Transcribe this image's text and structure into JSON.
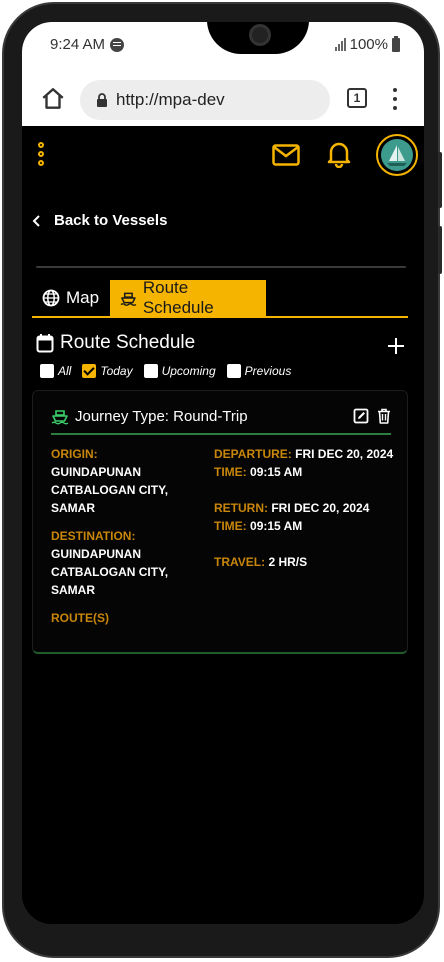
{
  "status_bar": {
    "time": "9:24 AM",
    "battery": "100%"
  },
  "browser": {
    "url": "http://mpa-dev",
    "tab_count": "1"
  },
  "header": {
    "back_label": "Back to Vessels"
  },
  "tabs": [
    {
      "label": "Map"
    },
    {
      "label": "Route Schedule"
    }
  ],
  "section": {
    "title": "Route Schedule"
  },
  "filters": [
    {
      "label": "All",
      "checked": false
    },
    {
      "label": "Today",
      "checked": true
    },
    {
      "label": "Upcoming",
      "checked": false
    },
    {
      "label": "Previous",
      "checked": false
    }
  ],
  "card": {
    "journey_type": "Journey Type: Round-Trip",
    "origin_label": "ORIGIN:",
    "origin_value": "GUINDAPUNAN CATBALOGAN CITY, SAMAR",
    "destination_label": "DESTINATION:",
    "destination_value": "GUINDAPUNAN CATBALOGAN CITY, SAMAR",
    "routes_label": "ROUTE(S)",
    "departure_label": "DEPARTURE:",
    "departure_value": "FRI DEC 20, 2024",
    "departure_time_label": "TIME:",
    "departure_time_value": "09:15 AM",
    "return_label": "RETURN:",
    "return_value": "FRI DEC 20, 2024",
    "return_time_label": "TIME:",
    "return_time_value": "09:15 AM",
    "travel_label": "TRAVEL:",
    "travel_value": "2 HR/S"
  },
  "colors": {
    "accent": "#f5b400",
    "label": "#c8860a",
    "journey_icon": "#3ccf6a",
    "background": "#000000"
  }
}
